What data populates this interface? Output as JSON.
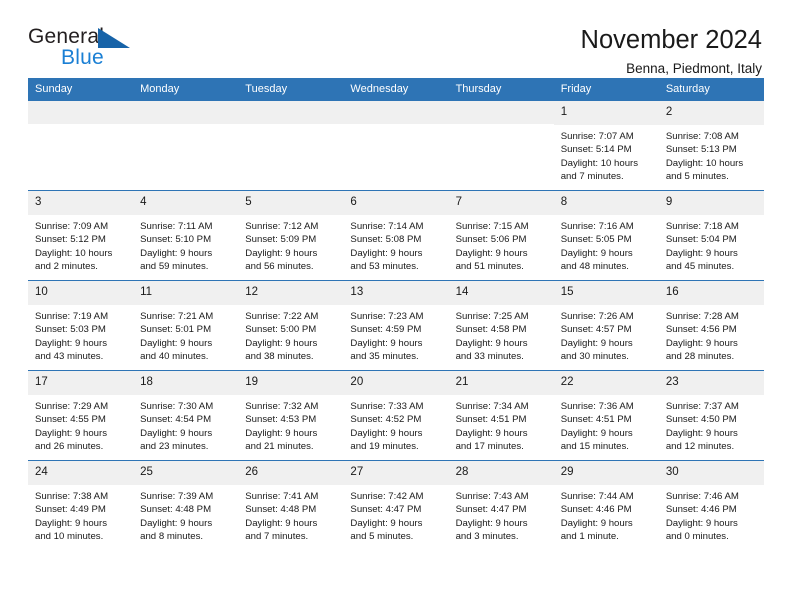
{
  "brand": {
    "name_part1": "General",
    "name_part2": "Blue",
    "triangle_color": "#1763a8",
    "blue_text_color": "#1a7fd4"
  },
  "header": {
    "month_title": "November 2024",
    "location": "Benna, Piedmont, Italy",
    "accent_color": "#2e74b5",
    "daynum_band_color": "#f0f0f0"
  },
  "weekday_headers": [
    "Sunday",
    "Monday",
    "Tuesday",
    "Wednesday",
    "Thursday",
    "Friday",
    "Saturday"
  ],
  "weeks": [
    [
      {
        "day": "",
        "sunrise": "",
        "sunset": "",
        "daylight_line1": "",
        "daylight_line2": ""
      },
      {
        "day": "",
        "sunrise": "",
        "sunset": "",
        "daylight_line1": "",
        "daylight_line2": ""
      },
      {
        "day": "",
        "sunrise": "",
        "sunset": "",
        "daylight_line1": "",
        "daylight_line2": ""
      },
      {
        "day": "",
        "sunrise": "",
        "sunset": "",
        "daylight_line1": "",
        "daylight_line2": ""
      },
      {
        "day": "",
        "sunrise": "",
        "sunset": "",
        "daylight_line1": "",
        "daylight_line2": ""
      },
      {
        "day": "1",
        "sunrise": "Sunrise: 7:07 AM",
        "sunset": "Sunset: 5:14 PM",
        "daylight_line1": "Daylight: 10 hours",
        "daylight_line2": "and 7 minutes."
      },
      {
        "day": "2",
        "sunrise": "Sunrise: 7:08 AM",
        "sunset": "Sunset: 5:13 PM",
        "daylight_line1": "Daylight: 10 hours",
        "daylight_line2": "and 5 minutes."
      }
    ],
    [
      {
        "day": "3",
        "sunrise": "Sunrise: 7:09 AM",
        "sunset": "Sunset: 5:12 PM",
        "daylight_line1": "Daylight: 10 hours",
        "daylight_line2": "and 2 minutes."
      },
      {
        "day": "4",
        "sunrise": "Sunrise: 7:11 AM",
        "sunset": "Sunset: 5:10 PM",
        "daylight_line1": "Daylight: 9 hours",
        "daylight_line2": "and 59 minutes."
      },
      {
        "day": "5",
        "sunrise": "Sunrise: 7:12 AM",
        "sunset": "Sunset: 5:09 PM",
        "daylight_line1": "Daylight: 9 hours",
        "daylight_line2": "and 56 minutes."
      },
      {
        "day": "6",
        "sunrise": "Sunrise: 7:14 AM",
        "sunset": "Sunset: 5:08 PM",
        "daylight_line1": "Daylight: 9 hours",
        "daylight_line2": "and 53 minutes."
      },
      {
        "day": "7",
        "sunrise": "Sunrise: 7:15 AM",
        "sunset": "Sunset: 5:06 PM",
        "daylight_line1": "Daylight: 9 hours",
        "daylight_line2": "and 51 minutes."
      },
      {
        "day": "8",
        "sunrise": "Sunrise: 7:16 AM",
        "sunset": "Sunset: 5:05 PM",
        "daylight_line1": "Daylight: 9 hours",
        "daylight_line2": "and 48 minutes."
      },
      {
        "day": "9",
        "sunrise": "Sunrise: 7:18 AM",
        "sunset": "Sunset: 5:04 PM",
        "daylight_line1": "Daylight: 9 hours",
        "daylight_line2": "and 45 minutes."
      }
    ],
    [
      {
        "day": "10",
        "sunrise": "Sunrise: 7:19 AM",
        "sunset": "Sunset: 5:03 PM",
        "daylight_line1": "Daylight: 9 hours",
        "daylight_line2": "and 43 minutes."
      },
      {
        "day": "11",
        "sunrise": "Sunrise: 7:21 AM",
        "sunset": "Sunset: 5:01 PM",
        "daylight_line1": "Daylight: 9 hours",
        "daylight_line2": "and 40 minutes."
      },
      {
        "day": "12",
        "sunrise": "Sunrise: 7:22 AM",
        "sunset": "Sunset: 5:00 PM",
        "daylight_line1": "Daylight: 9 hours",
        "daylight_line2": "and 38 minutes."
      },
      {
        "day": "13",
        "sunrise": "Sunrise: 7:23 AM",
        "sunset": "Sunset: 4:59 PM",
        "daylight_line1": "Daylight: 9 hours",
        "daylight_line2": "and 35 minutes."
      },
      {
        "day": "14",
        "sunrise": "Sunrise: 7:25 AM",
        "sunset": "Sunset: 4:58 PM",
        "daylight_line1": "Daylight: 9 hours",
        "daylight_line2": "and 33 minutes."
      },
      {
        "day": "15",
        "sunrise": "Sunrise: 7:26 AM",
        "sunset": "Sunset: 4:57 PM",
        "daylight_line1": "Daylight: 9 hours",
        "daylight_line2": "and 30 minutes."
      },
      {
        "day": "16",
        "sunrise": "Sunrise: 7:28 AM",
        "sunset": "Sunset: 4:56 PM",
        "daylight_line1": "Daylight: 9 hours",
        "daylight_line2": "and 28 minutes."
      }
    ],
    [
      {
        "day": "17",
        "sunrise": "Sunrise: 7:29 AM",
        "sunset": "Sunset: 4:55 PM",
        "daylight_line1": "Daylight: 9 hours",
        "daylight_line2": "and 26 minutes."
      },
      {
        "day": "18",
        "sunrise": "Sunrise: 7:30 AM",
        "sunset": "Sunset: 4:54 PM",
        "daylight_line1": "Daylight: 9 hours",
        "daylight_line2": "and 23 minutes."
      },
      {
        "day": "19",
        "sunrise": "Sunrise: 7:32 AM",
        "sunset": "Sunset: 4:53 PM",
        "daylight_line1": "Daylight: 9 hours",
        "daylight_line2": "and 21 minutes."
      },
      {
        "day": "20",
        "sunrise": "Sunrise: 7:33 AM",
        "sunset": "Sunset: 4:52 PM",
        "daylight_line1": "Daylight: 9 hours",
        "daylight_line2": "and 19 minutes."
      },
      {
        "day": "21",
        "sunrise": "Sunrise: 7:34 AM",
        "sunset": "Sunset: 4:51 PM",
        "daylight_line1": "Daylight: 9 hours",
        "daylight_line2": "and 17 minutes."
      },
      {
        "day": "22",
        "sunrise": "Sunrise: 7:36 AM",
        "sunset": "Sunset: 4:51 PM",
        "daylight_line1": "Daylight: 9 hours",
        "daylight_line2": "and 15 minutes."
      },
      {
        "day": "23",
        "sunrise": "Sunrise: 7:37 AM",
        "sunset": "Sunset: 4:50 PM",
        "daylight_line1": "Daylight: 9 hours",
        "daylight_line2": "and 12 minutes."
      }
    ],
    [
      {
        "day": "24",
        "sunrise": "Sunrise: 7:38 AM",
        "sunset": "Sunset: 4:49 PM",
        "daylight_line1": "Daylight: 9 hours",
        "daylight_line2": "and 10 minutes."
      },
      {
        "day": "25",
        "sunrise": "Sunrise: 7:39 AM",
        "sunset": "Sunset: 4:48 PM",
        "daylight_line1": "Daylight: 9 hours",
        "daylight_line2": "and 8 minutes."
      },
      {
        "day": "26",
        "sunrise": "Sunrise: 7:41 AM",
        "sunset": "Sunset: 4:48 PM",
        "daylight_line1": "Daylight: 9 hours",
        "daylight_line2": "and 7 minutes."
      },
      {
        "day": "27",
        "sunrise": "Sunrise: 7:42 AM",
        "sunset": "Sunset: 4:47 PM",
        "daylight_line1": "Daylight: 9 hours",
        "daylight_line2": "and 5 minutes."
      },
      {
        "day": "28",
        "sunrise": "Sunrise: 7:43 AM",
        "sunset": "Sunset: 4:47 PM",
        "daylight_line1": "Daylight: 9 hours",
        "daylight_line2": "and 3 minutes."
      },
      {
        "day": "29",
        "sunrise": "Sunrise: 7:44 AM",
        "sunset": "Sunset: 4:46 PM",
        "daylight_line1": "Daylight: 9 hours",
        "daylight_line2": "and 1 minute."
      },
      {
        "day": "30",
        "sunrise": "Sunrise: 7:46 AM",
        "sunset": "Sunset: 4:46 PM",
        "daylight_line1": "Daylight: 9 hours",
        "daylight_line2": "and 0 minutes."
      }
    ]
  ]
}
